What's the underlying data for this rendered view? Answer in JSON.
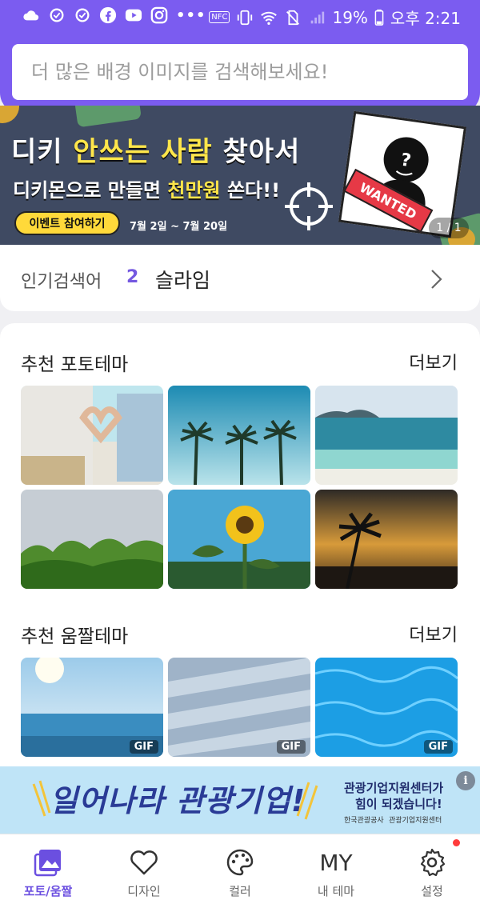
{
  "status_bar": {
    "icons_left": [
      "cloud-icon",
      "gear-check-icon",
      "gear-check-icon",
      "facebook-icon",
      "youtube-icon",
      "instagram-icon",
      "more-dots-icon"
    ],
    "nfc": "NFC",
    "battery": "19%",
    "time": "오후 2:21"
  },
  "search": {
    "placeholder": "더 많은 배경 이미지를 검색해보세요!"
  },
  "banner": {
    "title_part1": "디키 ",
    "title_highlight": "안쓰는 사람",
    "title_part2": " 찾아서",
    "subtitle_part1": "디키몬으로 만들면 ",
    "subtitle_highlight": "천만원",
    "subtitle_part2": " 쏜다!!",
    "button": "이벤트 참여하기",
    "dates": "7월 2일 ~ 7월 20일",
    "wanted": "WANTED",
    "counter": "1 / 1",
    "colors": {
      "background": "#3f4a62",
      "highlight": "#ffe64a",
      "button": "#ffd93a"
    }
  },
  "popular": {
    "label": "인기검색어",
    "rank": "2",
    "term": "슬라임"
  },
  "sections": {
    "photo": {
      "title": "추천 포토테마",
      "more": "더보기"
    },
    "gif": {
      "title": "추천 움짤테마",
      "more": "더보기"
    }
  },
  "gif_badges": [
    "GIF",
    "GIF",
    "GIF"
  ],
  "ad": {
    "main": "일어나라 관광기업!",
    "sub1": "관광기업지원센터가",
    "sub2": "힘이 되겠습니다!",
    "logo1": "한국관광공사",
    "logo2": "관광기업지원센터",
    "info": "i"
  },
  "nav": {
    "items": [
      {
        "label": "포토/움짤",
        "icon": "image-icon",
        "active": true
      },
      {
        "label": "디자인",
        "icon": "heart-icon",
        "active": false
      },
      {
        "label": "컬러",
        "icon": "palette-icon",
        "active": false
      },
      {
        "label": "내 테마",
        "icon": "my-icon",
        "icon_text": "MY",
        "active": false
      },
      {
        "label": "설정",
        "icon": "settings-gear-icon",
        "active": false
      }
    ]
  },
  "colors": {
    "accent": "#7b5cf0",
    "active_nav": "#6b4fe0"
  }
}
